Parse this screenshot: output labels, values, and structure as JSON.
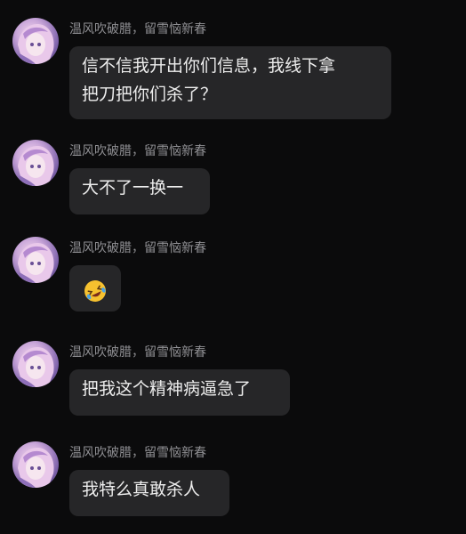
{
  "messages": [
    {
      "sender": "温风吹破腊，留雪恼新春",
      "text_lines": [
        "信不信我开出你们信息，我线下拿",
        "把刀把你们杀了？"
      ]
    },
    {
      "sender": "温风吹破腊，留雪恼新春",
      "text": "大不了一换一"
    },
    {
      "sender": "温风吹破腊，留雪恼新春",
      "emoji": "rolling-on-floor-laughing-emoji"
    },
    {
      "sender": "温风吹破腊，留雪恼新春",
      "text": "把我这个精神病逼急了"
    },
    {
      "sender": "温风吹破腊，留雪恼新春",
      "text": "我特么真敢杀人"
    }
  ],
  "colors": {
    "background": "#0b0b0c",
    "bubble": "#262628",
    "sender_text": "#8f8f93",
    "message_text": "#ededed"
  }
}
